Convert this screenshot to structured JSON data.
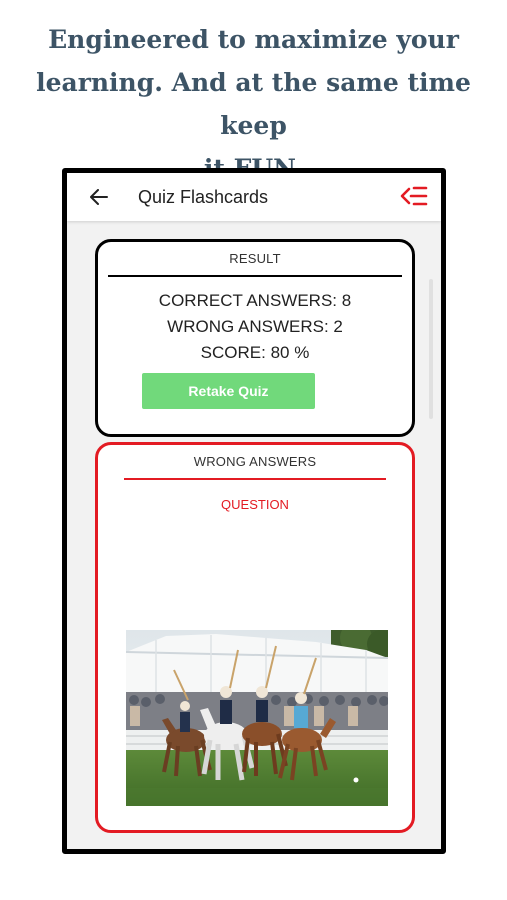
{
  "headline": {
    "line1": "Engineered to maximize your",
    "line2": "learning. And at the same time keep",
    "line3": "it FUN."
  },
  "appbar": {
    "title": "Quiz Flashcards",
    "back_icon": "arrow-left-icon",
    "menu_icon": "menu-collapse-icon",
    "menu_color": "#e31b23"
  },
  "result": {
    "header": "RESULT",
    "correct": "CORRECT ANSWERS: 8",
    "wrong": "WRONG ANSWERS: 2",
    "score": "SCORE: 80 %",
    "retake_label": "Retake Quiz"
  },
  "wrong_answers": {
    "header": "WRONG ANSWERS",
    "question_label": "QUESTION",
    "image_subject": "polo-match-photo"
  },
  "colors": {
    "headline": "#3d5466",
    "accent_red": "#e31b23",
    "retake_green": "#71d97b"
  }
}
